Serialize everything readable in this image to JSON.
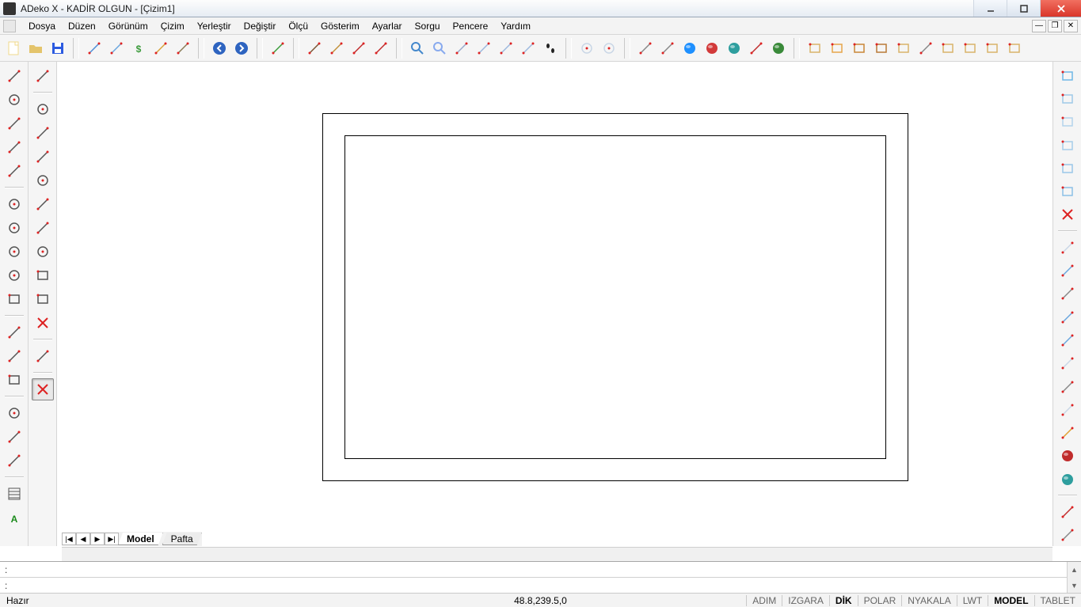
{
  "title": "ADeko X - KADİR OLGUN - [Çizim1]",
  "menu": [
    "Dosya",
    "Düzen",
    "Görünüm",
    "Çizim",
    "Yerleştir",
    "Değiştir",
    "Ölçü",
    "Gösterim",
    "Ayarlar",
    "Sorgu",
    "Pencere",
    "Yardım"
  ],
  "toolbar_top": [
    {
      "n": "new-icon",
      "c": "#f0d98a"
    },
    {
      "n": "open-icon",
      "c": "#e4c46b"
    },
    {
      "n": "save-icon",
      "c": "#2c5be0"
    },
    {
      "sep": true
    },
    {
      "n": "print-icon",
      "c": "#4c8ed6"
    },
    {
      "n": "print-preview-icon",
      "c": "#6aa6de"
    },
    {
      "n": "dollar-icon",
      "c": "#3c9b3c"
    },
    {
      "n": "clipboard-icon",
      "c": "#d6a23a"
    },
    {
      "n": "gear-icon",
      "c": "#8a7b55"
    },
    {
      "sep": true
    },
    {
      "n": "back-icon",
      "c": "#2e64c0"
    },
    {
      "n": "forward-icon",
      "c": "#2e64c0"
    },
    {
      "sep": true
    },
    {
      "n": "book-icon",
      "c": "#3a9b3a"
    },
    {
      "sep": true
    },
    {
      "n": "door-icon",
      "c": "#7a5432"
    },
    {
      "n": "measure-icon",
      "c": "#c2913a"
    },
    {
      "n": "dim-horiz-icon",
      "c": "#c02c2c"
    },
    {
      "n": "dim-vert-icon",
      "c": "#c02c2c"
    },
    {
      "sep": true
    },
    {
      "n": "zoom-icon",
      "c": "#4488cc"
    },
    {
      "n": "zoom-extents-icon",
      "c": "#88aaee"
    },
    {
      "n": "pan-icon",
      "c": "#99aacc"
    },
    {
      "n": "view-1-icon",
      "c": "#9cb8de"
    },
    {
      "n": "view-2-icon",
      "c": "#9cb8de"
    },
    {
      "n": "view-3-icon",
      "c": "#9cb8de"
    },
    {
      "n": "footprints-icon",
      "c": "#222"
    },
    {
      "sep": true
    },
    {
      "n": "ellipse-1-icon",
      "c": "#c9d6e6"
    },
    {
      "n": "ellipse-2-icon",
      "c": "#c9d6e6"
    },
    {
      "sep": true
    },
    {
      "n": "link-1-icon",
      "c": "#888"
    },
    {
      "n": "link-2-icon",
      "c": "#888"
    },
    {
      "n": "sphere-blue-icon",
      "c": "#1e90ff"
    },
    {
      "n": "sphere-red-icon",
      "c": "#d23a3a"
    },
    {
      "n": "globe-icon",
      "c": "#2e9e9e"
    },
    {
      "n": "glasses-icon",
      "c": "#c02c2c"
    },
    {
      "n": "world-icon",
      "c": "#3a8a3a"
    },
    {
      "sep": true
    },
    {
      "n": "panel-1-icon",
      "c": "#d9b36a"
    },
    {
      "n": "panel-2-icon",
      "c": "#e6a54a"
    },
    {
      "n": "panel-3-icon",
      "c": "#c98636"
    },
    {
      "n": "panel-4-icon",
      "c": "#b97a36"
    },
    {
      "n": "panel-5-icon",
      "c": "#d9b36a"
    },
    {
      "n": "hanger-icon",
      "c": "#888"
    },
    {
      "n": "panel-6-icon",
      "c": "#d9b36a"
    },
    {
      "n": "panel-7-icon",
      "c": "#d9b36a"
    },
    {
      "n": "panel-8-icon",
      "c": "#d9b36a"
    },
    {
      "n": "grid-icon",
      "c": "#d9b36a"
    }
  ],
  "left_tools_a": [
    {
      "n": "line-icon"
    },
    {
      "n": "arc-icon"
    },
    {
      "n": "polyline-icon"
    },
    {
      "n": "spline-icon"
    },
    {
      "n": "pencil-icon"
    },
    {
      "sep": true
    },
    {
      "n": "circle-center-icon"
    },
    {
      "n": "circle-2pt-icon"
    },
    {
      "n": "ellipse-icon"
    },
    {
      "n": "ellipse-arc-icon"
    },
    {
      "n": "rect-icon"
    },
    {
      "sep": true
    },
    {
      "n": "polygon-fill-icon"
    },
    {
      "n": "polygon-icon"
    },
    {
      "n": "region-icon"
    },
    {
      "sep": true
    },
    {
      "n": "ring-icon"
    },
    {
      "n": "wedge-icon"
    },
    {
      "n": "pie-icon"
    },
    {
      "sep": true
    },
    {
      "n": "hatch-icon"
    },
    {
      "n": "text-icon"
    }
  ],
  "left_tools_b": [
    {
      "n": "snap-endpoint-icon"
    },
    {
      "sep": true
    },
    {
      "n": "snap-circle-icon"
    },
    {
      "n": "snap-line-icon"
    },
    {
      "n": "snap-mid-icon"
    },
    {
      "n": "snap-center-icon"
    },
    {
      "n": "snap-node-icon"
    },
    {
      "n": "snap-tangent-icon"
    },
    {
      "n": "snap-quad-icon"
    },
    {
      "n": "snap-rect-icon"
    },
    {
      "n": "snap-cross-icon"
    },
    {
      "n": "snap-x-icon"
    },
    {
      "sep": true
    },
    {
      "n": "snap-extend-icon"
    },
    {
      "sep": true
    },
    {
      "n": "snap-none-icon",
      "sel": true
    }
  ],
  "right_tools": [
    {
      "n": "box-1-icon",
      "c": "#6fb8e6"
    },
    {
      "n": "box-2-icon",
      "c": "#9ecae8"
    },
    {
      "n": "box-3-icon",
      "c": "#b3d4ec"
    },
    {
      "n": "box-4-icon",
      "c": "#a7cdea"
    },
    {
      "n": "box-5-icon",
      "c": "#9ac7e8"
    },
    {
      "n": "box-6-icon",
      "c": "#8cc0e6"
    },
    {
      "n": "box-x-icon",
      "c": "#cfd8e0"
    },
    {
      "sep": true
    },
    {
      "n": "house-icon",
      "c": "#c9d6e6"
    },
    {
      "n": "server-icon",
      "c": "#6aa6de"
    },
    {
      "n": "drive-icon",
      "c": "#888"
    },
    {
      "n": "machine-icon",
      "c": "#6aa6de"
    },
    {
      "n": "robot-icon",
      "c": "#6aa6de"
    },
    {
      "n": "printer-icon",
      "c": "#c9d6e6"
    },
    {
      "n": "gear-2-icon",
      "c": "#888"
    },
    {
      "n": "list-icon",
      "c": "#c9d6e6"
    },
    {
      "n": "bulb-icon",
      "c": "#e0a030"
    },
    {
      "n": "record-icon",
      "c": "#c02c2c"
    },
    {
      "n": "sphere-icon",
      "c": "#2e9e9e"
    },
    {
      "sep": true
    },
    {
      "n": "palette-icon",
      "c": "#c02c2c"
    },
    {
      "n": "swatch-icon",
      "c": "#888"
    }
  ],
  "sheet_nav": [
    "|◀",
    "◀",
    "▶",
    "▶|"
  ],
  "tabs": [
    {
      "label": "Model",
      "active": true
    },
    {
      "label": "Pafta",
      "active": false
    }
  ],
  "cmd_prompt": ":",
  "status": {
    "left": "Hazır",
    "coords": "48.8,239.5,0",
    "toggles": [
      {
        "label": "ADIM",
        "on": false
      },
      {
        "label": "IZGARA",
        "on": false
      },
      {
        "label": "DİK",
        "on": true
      },
      {
        "label": "POLAR",
        "on": false
      },
      {
        "label": "NYAKALA",
        "on": false
      },
      {
        "label": "LWT",
        "on": false
      },
      {
        "label": "MODEL",
        "on": true
      },
      {
        "label": "TABLET",
        "on": false
      }
    ]
  }
}
